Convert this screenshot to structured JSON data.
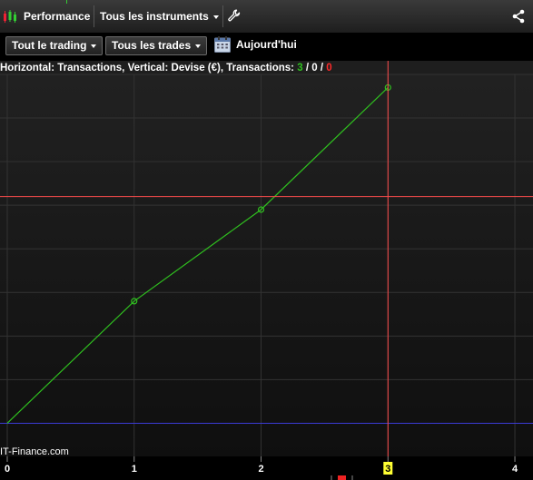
{
  "header": {
    "title": "Performance",
    "instruments_label": "Tous les instruments"
  },
  "toolbar": {
    "trading_filter": "Tout le trading",
    "trades_filter": "Tous les trades",
    "date_label": "Aujourd'hui"
  },
  "icons": {
    "app": "candlestick-chart-icon",
    "settings": "wrench-icon",
    "share": "share-icon",
    "calendar": "calendar-icon"
  },
  "colors": {
    "series": "#2fbf1f",
    "crosshair": "#ff4d4d",
    "baseline": "#3b3bd6",
    "wins": "#2fbf1f",
    "losses": "#ff2a2a",
    "cursor_label_bg": "#ffff33"
  },
  "chart_data": {
    "type": "line",
    "info": {
      "prefix": "Horizontal: Transactions, Vertical: Devise (€), Transactions: ",
      "wins": "3",
      "sep1": " / ",
      "neutral": "0",
      "sep2": " / ",
      "losses": "0"
    },
    "x": [
      0,
      1,
      2,
      3
    ],
    "values": [
      0,
      1.4,
      2.45,
      3.85
    ],
    "xlim": [
      0,
      4.2
    ],
    "ylim": [
      -0.38,
      4.0
    ],
    "x_ticks": [
      "0",
      "1",
      "2",
      "3",
      "4"
    ],
    "cursor": {
      "x": 3,
      "y": 2.6,
      "x_label": "3"
    },
    "baseline_y": 0,
    "watermark": "IT-Finance.com",
    "grid": true
  }
}
